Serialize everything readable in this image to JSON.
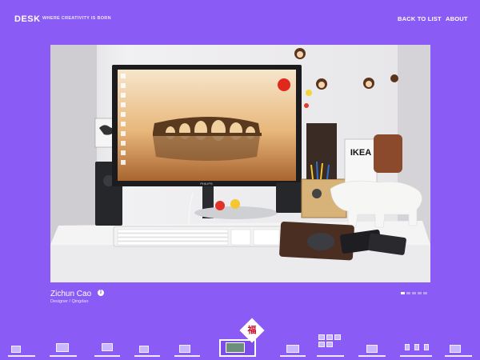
{
  "header": {
    "brand": "DESK",
    "tagline": "WHERE CREATIVITY IS BORN",
    "nav": {
      "back": "BACK TO LIST",
      "about": "ABOUT"
    }
  },
  "photo": {
    "logo": "IKEA",
    "monitor_brand": "PHILIPS"
  },
  "caption": {
    "name": "Zichun Cao",
    "role": "Designer / Qingdao",
    "info_icon": "info-icon"
  },
  "pager": {
    "count": 5,
    "active": 0
  },
  "filmstrip": {
    "count": 11,
    "active_index": 5,
    "seal_glyph": "福"
  },
  "colors": {
    "background": "#8b5cf5",
    "text": "#ffffff",
    "seal": "#c8102e"
  }
}
